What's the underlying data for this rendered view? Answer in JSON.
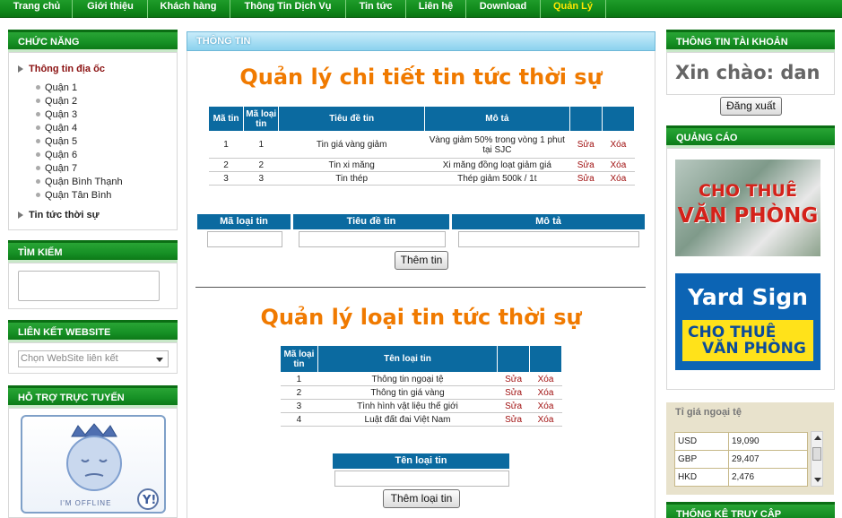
{
  "nav": {
    "items": [
      "Trang chủ",
      "Giới thiệu",
      "Khách hàng",
      "Thông Tin Dịch Vụ",
      "Tin tức",
      "Liên hệ",
      "Download",
      "Quản Lý"
    ],
    "active": "Quản Lý"
  },
  "left": {
    "functions_title": "CHỨC NĂNG",
    "menu": {
      "real_estate": "Thông tin địa ốc",
      "districts": [
        "Quận 1",
        "Quận 2",
        "Quận 3",
        "Quận 4",
        "Quận 5",
        "Quận 6",
        "Quận 7",
        "Quận Bình Thạnh",
        "Quận Tân Bình"
      ],
      "news": "Tin tức thời sự"
    },
    "search_title": "TÌM KIẾM",
    "links_title": "LIÊN KẾT WEBSITE",
    "links_select": "Chọn WebSite liên kết",
    "support_title": "HỖ TRỢ TRỰC TUYẾN",
    "yahoo_status": "I'M OFFLINE"
  },
  "center": {
    "header": "THÔNG TIN",
    "news_title": "Quản lý chi tiết tin tức thời sự",
    "news_table": {
      "headers": [
        "Mã tin",
        "Mã loại tin",
        "Tiêu đề tin",
        "Mô tả",
        "",
        ""
      ],
      "rows": [
        [
          "1",
          "1",
          "Tin giá vàng giảm",
          "Vàng giảm 50% trong vòng 1 phut tại SJC",
          "Sửa",
          "Xóa"
        ],
        [
          "2",
          "2",
          "Tin xi măng",
          "Xi măng đồng loạt giảm giá",
          "Sửa",
          "Xóa"
        ],
        [
          "3",
          "3",
          "Tin thép",
          "Thép giảm 500k / 1t",
          "Sửa",
          "Xóa"
        ]
      ]
    },
    "news_form": {
      "labels": [
        "Mã loại tin",
        "Tiêu đề tin",
        "Mô tả"
      ],
      "button": "Thêm tin"
    },
    "category_title": "Quản lý loại tin tức thời sự",
    "category_table": {
      "headers": [
        "Mã loại tin",
        "Tên loại tin",
        "",
        ""
      ],
      "rows": [
        [
          "1",
          "Thông tin ngoại tệ",
          "Sửa",
          "Xóa"
        ],
        [
          "2",
          "Thông tin giá vàng",
          "Sửa",
          "Xóa"
        ],
        [
          "3",
          "Tình hình vật liệu thế giới",
          "Sửa",
          "Xóa"
        ],
        [
          "4",
          "Luật đất đai Việt Nam",
          "Sửa",
          "Xóa"
        ]
      ]
    },
    "category_form": {
      "label": "Tên loại tin",
      "button": "Thêm loại tin"
    }
  },
  "right": {
    "account_title": "THÔNG TIN TÀI KHOẢN",
    "greeting": "Xin chào: dan",
    "logout": "Đăng xuất",
    "ads_title": "QUẢNG CÁO",
    "ad1_line1": "CHO THUÊ",
    "ad1_line2": "VĂN PHÒNG",
    "ad2_title": "Yard Sign",
    "ad2_line1": "CHO THUÊ",
    "ad2_line2": "VĂN PHÒNG",
    "rates_title": "Tỉ giá ngoại tệ",
    "rates": [
      {
        "code": "USD",
        "value": "19,090"
      },
      {
        "code": "GBP",
        "value": "29,407"
      },
      {
        "code": "HKD",
        "value": "2,476"
      }
    ],
    "stats_title": "THỐNG KÊ TRUY CẬP"
  }
}
